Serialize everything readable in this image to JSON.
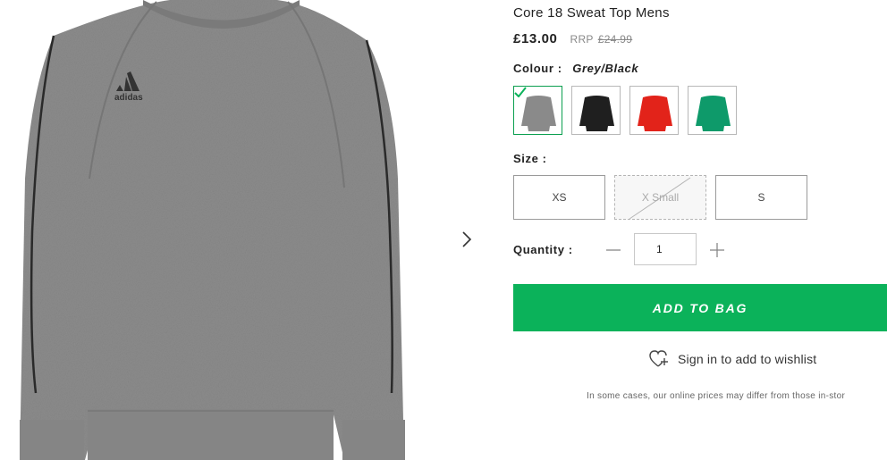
{
  "product": {
    "title": "Core 18 Sweat Top Mens",
    "price": "£13.00",
    "rrp_label": "RRP",
    "rrp_value": "£24.99",
    "brand_logo_text": "adidas"
  },
  "colour": {
    "label": "Colour :",
    "selected": "Grey/Black",
    "swatches": [
      {
        "name": "Grey",
        "color": "#8a8a8a",
        "selected": true
      },
      {
        "name": "Black",
        "color": "#1f1f1f",
        "selected": false
      },
      {
        "name": "Red",
        "color": "#e2231a",
        "selected": false
      },
      {
        "name": "Green",
        "color": "#0e9a6a",
        "selected": false
      }
    ]
  },
  "size": {
    "label": "Size :",
    "options": [
      {
        "label": "XS",
        "available": true
      },
      {
        "label": "X Small",
        "available": false
      },
      {
        "label": "S",
        "available": true
      }
    ]
  },
  "quantity": {
    "label": "Quantity :",
    "value": "1"
  },
  "actions": {
    "add_to_bag": "ADD TO BAG",
    "wishlist": "Sign in to add to wishlist"
  },
  "disclaimer": "In some cases, our online prices may differ from those in-stor",
  "colors": {
    "accent": "#0bb25a",
    "selected_border": "#0b9f4f",
    "sweater": "#8c8c8c"
  },
  "icons": {
    "next": "chevron-right-icon",
    "minus": "minus-icon",
    "plus": "plus-icon",
    "wishlist": "heart-plus-icon",
    "selected": "checkmark-icon"
  }
}
